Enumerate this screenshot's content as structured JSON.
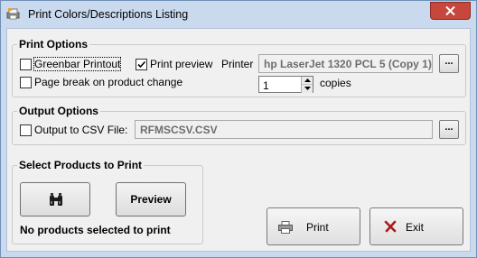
{
  "window": {
    "title": "Print Colors/Descriptions Listing",
    "close_icon": "close-icon",
    "app_icon": "app-icon"
  },
  "print_options": {
    "group_title": "Print Options",
    "greenbar_label": "Greenbar Printout",
    "greenbar_checked": false,
    "print_preview_label": "Print preview",
    "print_preview_checked": true,
    "page_break_label": "Page break on product change",
    "page_break_checked": false,
    "printer_label": "Printer",
    "printer_value": "hp LaserJet 1320 PCL 5 (Copy 1)",
    "printer_browse_label": "...",
    "copies_value": "1",
    "copies_label": "copies"
  },
  "output_options": {
    "group_title": "Output Options",
    "csv_label": "Output to CSV File:",
    "csv_checked": false,
    "csv_value": "RFMSCSV.CSV",
    "csv_browse_label": "..."
  },
  "select_products": {
    "group_title": "Select Products to Print",
    "search_icon": "binoculars-icon",
    "preview_label": "Preview",
    "status_text": "No products selected to print"
  },
  "actions": {
    "print_label": "Print",
    "print_icon": "printer-icon",
    "exit_label": "Exit",
    "exit_icon": "red-x-icon"
  },
  "colors": {
    "title_bar": "#c9d9ee",
    "close_button": "#c7473d",
    "client_bg": "#f0f0f0"
  }
}
